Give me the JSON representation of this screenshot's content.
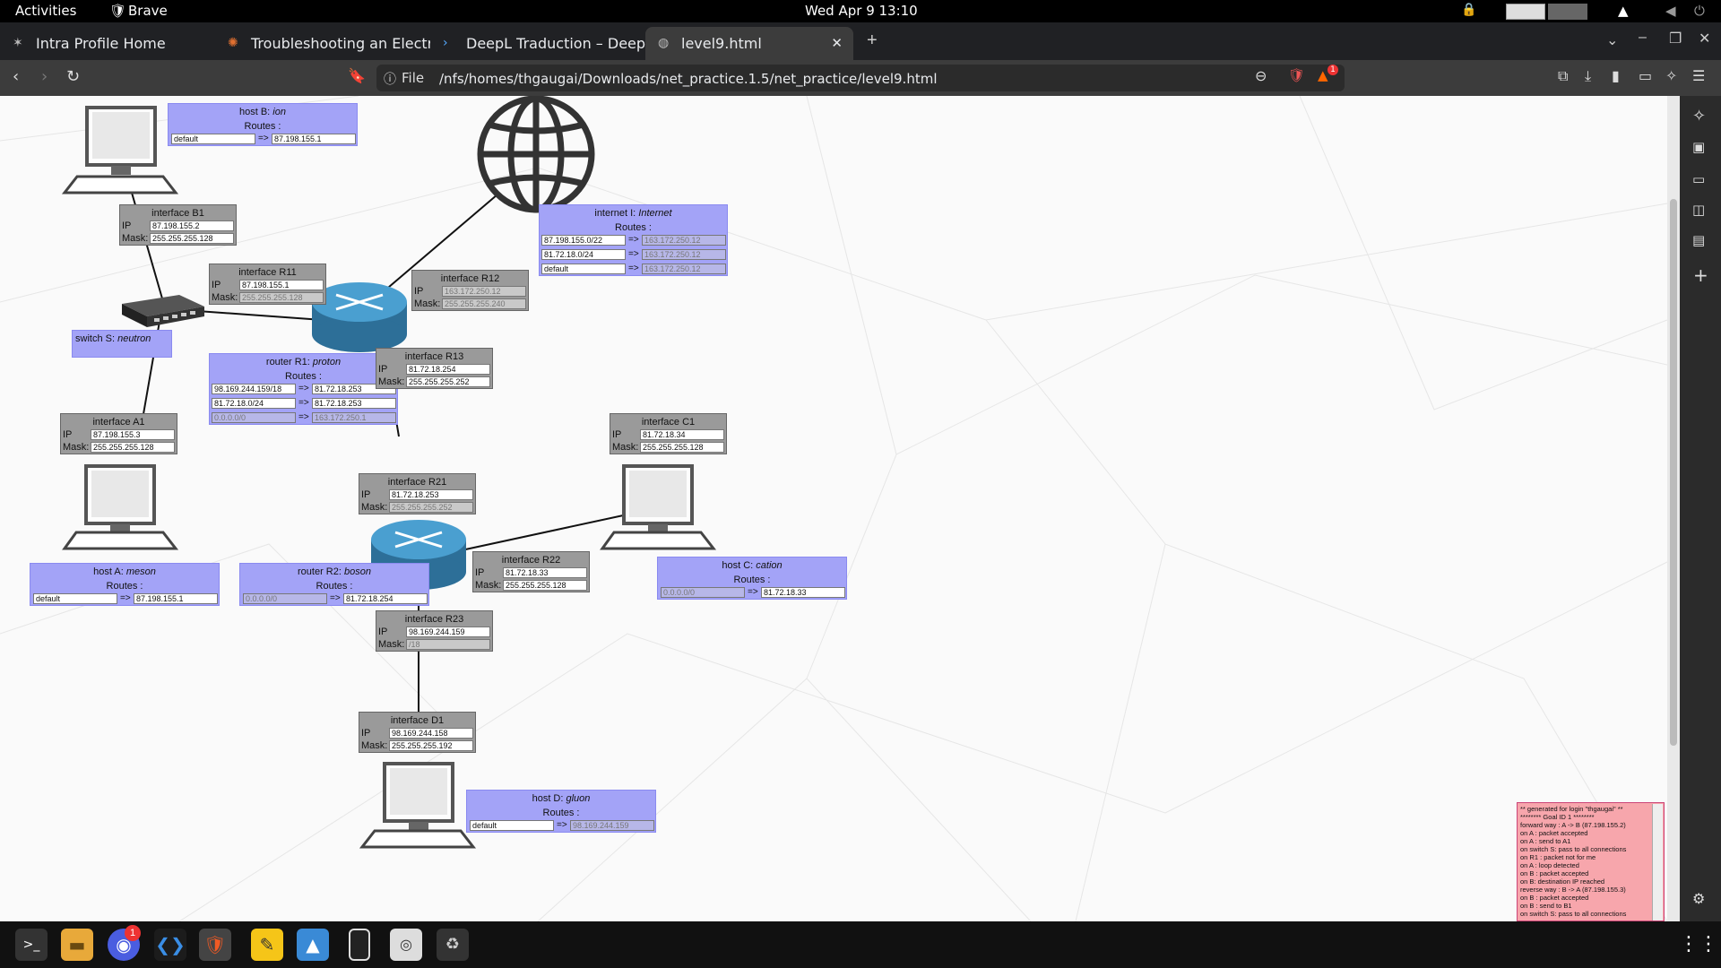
{
  "topbar": {
    "activities": "Activities",
    "app": "Brave",
    "clock": "Wed Apr 9  13:10"
  },
  "tabs": [
    {
      "title": "Intra Profile Home"
    },
    {
      "title": "Troubleshooting an Electr"
    },
    {
      "title": "DeepL Traduction – DeepL"
    },
    {
      "title": "level9.html"
    }
  ],
  "address": {
    "scheme": "File",
    "url": "/nfs/homes/thgaugai/Downloads/net_practice.1.5/net_practice/level9.html"
  },
  "notifications": {
    "badge_brave": "1",
    "dock_badge": "1"
  },
  "netpractice": {
    "hostB": {
      "name": "host B: ",
      "em": "ion",
      "routes_label": "Routes :",
      "dest": "default",
      "gw": "87.198.155.1"
    },
    "ifB1": {
      "title": "interface B1",
      "ip": "87.198.155.2",
      "mask": "255.255.255.128"
    },
    "ifR11": {
      "title": "interface R11",
      "ip": "87.198.155.1",
      "mask": "255.255.255.128"
    },
    "ifR12": {
      "title": "interface R12",
      "ip": "163.172.250.12",
      "mask": "255.255.255.240"
    },
    "ifR13": {
      "title": "interface R13",
      "ip": "81.72.18.254",
      "mask": "255.255.255.252"
    },
    "internet": {
      "name": "internet I: ",
      "em": "Internet",
      "routes_label": "Routes :",
      "routes": [
        [
          "87.198.155.0/22",
          "163.172.250.12"
        ],
        [
          "81.72.18.0/24",
          "163.172.250.12"
        ],
        [
          "default",
          "163.172.250.12"
        ]
      ]
    },
    "switchS": {
      "name": "switch S: ",
      "em": "neutron"
    },
    "routerR1": {
      "name": "router R1: ",
      "em": "proton",
      "routes_label": "Routes :",
      "routes": [
        [
          "98.169.244.159/18",
          "81.72.18.253"
        ],
        [
          "81.72.18.0/24",
          "81.72.18.253"
        ],
        [
          "0.0.0.0/0",
          "163.172.250.1"
        ]
      ]
    },
    "ifA1": {
      "title": "interface A1",
      "ip": "87.198.155.3",
      "mask": "255.255.255.128"
    },
    "ifC1": {
      "title": "interface C1",
      "ip": "81.72.18.34",
      "mask": "255.255.255.128"
    },
    "ifR21": {
      "title": "interface R21",
      "ip": "81.72.18.253",
      "mask": "255.255.255.252"
    },
    "ifR22": {
      "title": "interface R22",
      "ip": "81.72.18.33",
      "mask": "255.255.255.128"
    },
    "ifR23": {
      "title": "interface R23",
      "ip": "98.169.244.159",
      "mask": "/18"
    },
    "ifD1": {
      "title": "interface D1",
      "ip": "98.169.244.158",
      "mask": "255.255.255.192"
    },
    "hostA": {
      "name": "host A: ",
      "em": "meson",
      "routes_label": "Routes :",
      "dest": "default",
      "gw": "87.198.155.1"
    },
    "routerR2": {
      "name": "router R2: ",
      "em": "boson",
      "routes_label": "Routes :",
      "dest": "0.0.0.0/0",
      "gw": "81.72.18.254"
    },
    "hostC": {
      "name": "host C: ",
      "em": "cation",
      "routes_label": "Routes :",
      "dest": "0.0.0.0/0",
      "gw": "81.72.18.33"
    },
    "hostD": {
      "name": "host D: ",
      "em": "gluon",
      "routes_label": "Routes :",
      "dest": "default",
      "gw": "98.169.244.159"
    },
    "labels": {
      "ip": "IP",
      "mask": "Mask:",
      "arrow": "=>"
    }
  },
  "log": {
    "text": "** generated for login \"thgaugai\" **\n******** Goal ID 1 ********\nforward way : A -> B (87.198.155.2)\non A : packet accepted\non A : send to A1\non switch S: pass to all connections\non R1 : packet not for me\non A : loop detected\non B : packet accepted\non B: destination IP reached\nreverse way : B -> A (87.198.155.3)\non B : packet accepted\non B : send to B1\non switch S: pass to all connections"
  }
}
